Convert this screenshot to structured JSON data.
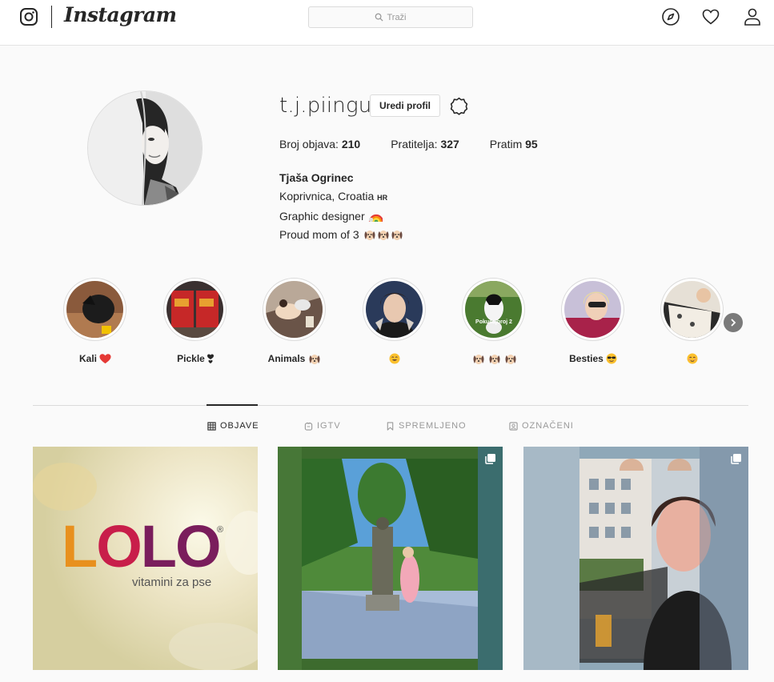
{
  "app": {
    "wordmark": "Instagram"
  },
  "search": {
    "placeholder": "Traži"
  },
  "profile": {
    "username": "t.j.piingu",
    "edit_button": "Uredi profil",
    "stats": {
      "posts_label": "Broj objava:",
      "posts_value": "210",
      "followers_label": "Pratitelja:",
      "followers_value": "327",
      "following_label": "Pratim",
      "following_value": "95"
    },
    "bio": {
      "name": "Tjaša Ogrinec",
      "location": "Koprivnica, Croatia",
      "location_code": "HR",
      "line2": "Graphic designer",
      "line3": "Proud mom of 3"
    }
  },
  "highlights": [
    {
      "label": "Kali"
    },
    {
      "label": "Pickle"
    },
    {
      "label": "Animals"
    },
    {
      "label": ""
    },
    {
      "label": ""
    },
    {
      "label": "Besties"
    },
    {
      "label": ""
    }
  ],
  "highlight_overlay_text": "Pokušajbroj 2",
  "tabs": [
    {
      "label": "OBJAVE",
      "icon": "grid-icon"
    },
    {
      "label": "IGTV",
      "icon": "igtv-icon"
    },
    {
      "label": "SPREMLJENO",
      "icon": "bookmark-icon"
    },
    {
      "label": "OZNAČENI",
      "icon": "tagged-icon"
    }
  ],
  "posts": {
    "lolo_brand": "LOLO",
    "lolo_registered": "®",
    "lolo_tagline": "vitamini za pse"
  },
  "colors": {
    "lolo_orange": "#e8901e",
    "lolo_red": "#c81e4a",
    "lolo_purple": "#7a1d5c"
  }
}
